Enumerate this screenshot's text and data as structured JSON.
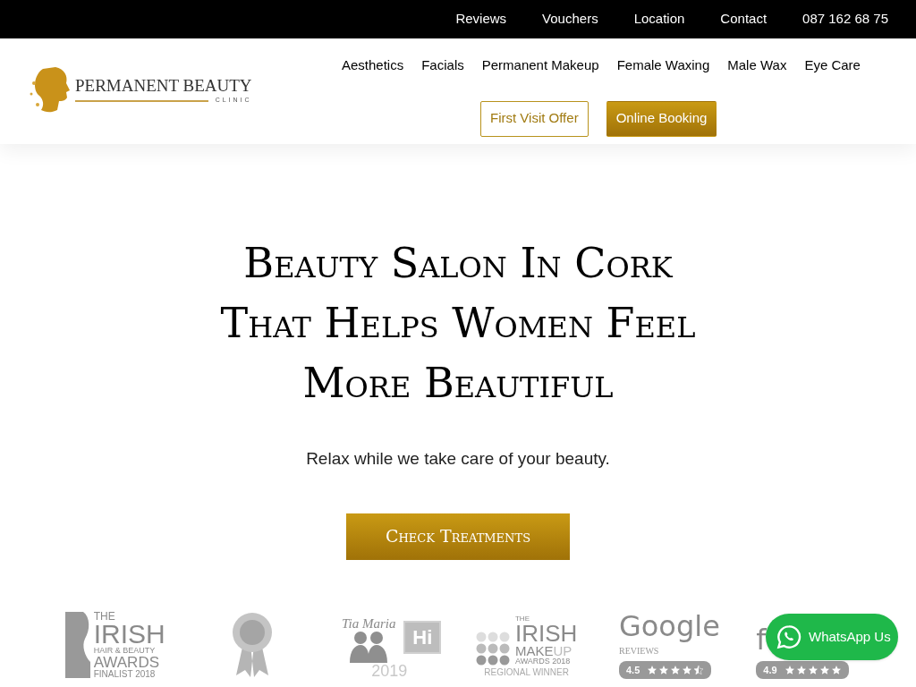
{
  "top_bar": {
    "links": [
      "Reviews",
      "Vouchers",
      "Location",
      "Contact",
      "087 162 68 75"
    ]
  },
  "header": {
    "logo": {
      "name": "PERMANENT BEAUTY",
      "sub": "CLINIC"
    },
    "nav": [
      "Aesthetics",
      "Facials",
      "Permanent Makeup",
      "Female Waxing",
      "Male Wax",
      "Eye Care"
    ],
    "buttons": [
      {
        "label": "First Visit Offer",
        "kind": "outline"
      },
      {
        "label": "Online Booking",
        "kind": "filled"
      }
    ]
  },
  "hero": {
    "title_lines": [
      "Beauty Salon In Cork",
      "That Helps Women Feel",
      "More Beautiful"
    ],
    "subtitle": "Relax while we take care of your beauty.",
    "cta": "Check Treatments"
  },
  "awards": [
    {
      "kind": "irish-hair",
      "lines": [
        "THE",
        "IRISH",
        "HAIR & BEAUTY",
        "AWARDS",
        "FINALIST 2018"
      ]
    },
    {
      "kind": "rosette"
    },
    {
      "kind": "tia-maria",
      "lines": [
        "Tia Maria",
        "Hi",
        "2019"
      ]
    },
    {
      "kind": "irish-makeup",
      "lines": [
        "THE",
        "IRISH",
        "MAKE",
        "UP",
        "AWARDS 2018",
        "REGIONAL WINNER"
      ]
    },
    {
      "kind": "rating",
      "lines": [
        "Google",
        "REVIEWS"
      ],
      "score": "4.5",
      "stars": 4.5
    },
    {
      "kind": "rating",
      "lines": [
        "f"
      ],
      "score": "4.9",
      "stars": 5
    }
  ],
  "whatsapp": {
    "label": "WhatsApp Us"
  }
}
